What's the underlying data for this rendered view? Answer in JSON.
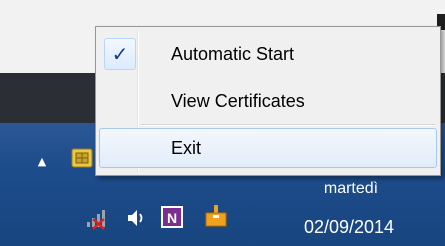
{
  "context_menu": {
    "items": [
      {
        "label": "Automatic Start",
        "checked": true
      },
      {
        "label": "View Certificates",
        "checked": false
      },
      {
        "label": "Exit",
        "checked": false,
        "highlighted": true
      }
    ],
    "check_glyph": "✓"
  },
  "tray": {
    "overflow_glyph": "▲",
    "icons": [
      "smart-card-reader-icon",
      "network-disconnected-icon",
      "speaker-icon",
      "onenote-icon",
      "sticky-briefcase-icon"
    ],
    "clock": {
      "day": "martedì",
      "date": "02/09/2014"
    }
  },
  "colors": {
    "taskbar": "#1e4d8c",
    "menu_background": "#f0f0f0",
    "menu_hover_border": "#a8c8ef",
    "onenote_purple": "#7a2f8e"
  }
}
